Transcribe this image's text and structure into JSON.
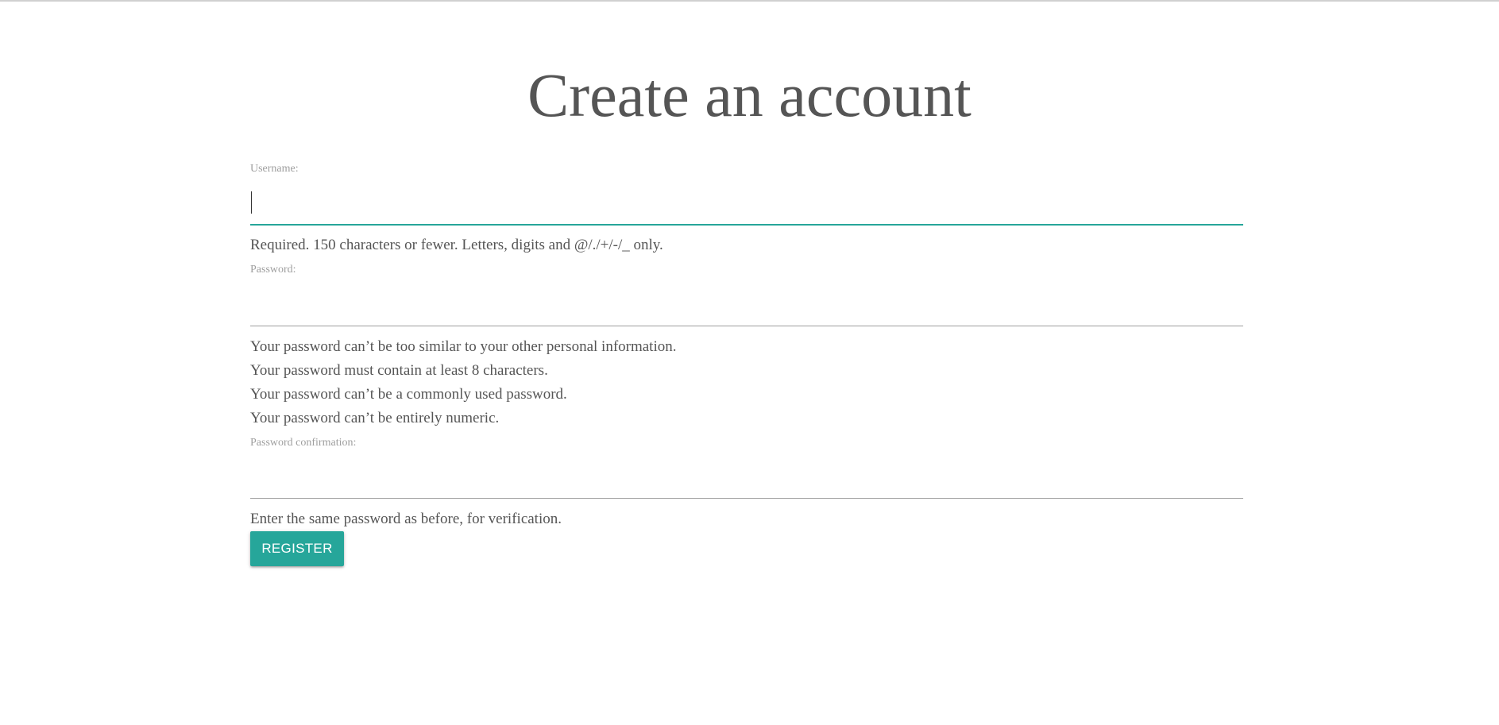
{
  "page": {
    "title": "Create an account"
  },
  "form": {
    "username": {
      "label": "Username:",
      "value": "",
      "help": "Required. 150 characters or fewer. Letters, digits and @/./+/-/_ only."
    },
    "password": {
      "label": "Password:",
      "value": "",
      "help": [
        "Your password can’t be too similar to your other personal information.",
        "Your password must contain at least 8 characters.",
        "Your password can’t be a commonly used password.",
        "Your password can’t be entirely numeric."
      ]
    },
    "password_confirmation": {
      "label": "Password confirmation:",
      "value": "",
      "help": "Enter the same password as before, for verification."
    },
    "submit_label": "REGISTER"
  },
  "colors": {
    "accent": "#26a69a",
    "text": "#555555",
    "label": "#9e9e9e"
  }
}
